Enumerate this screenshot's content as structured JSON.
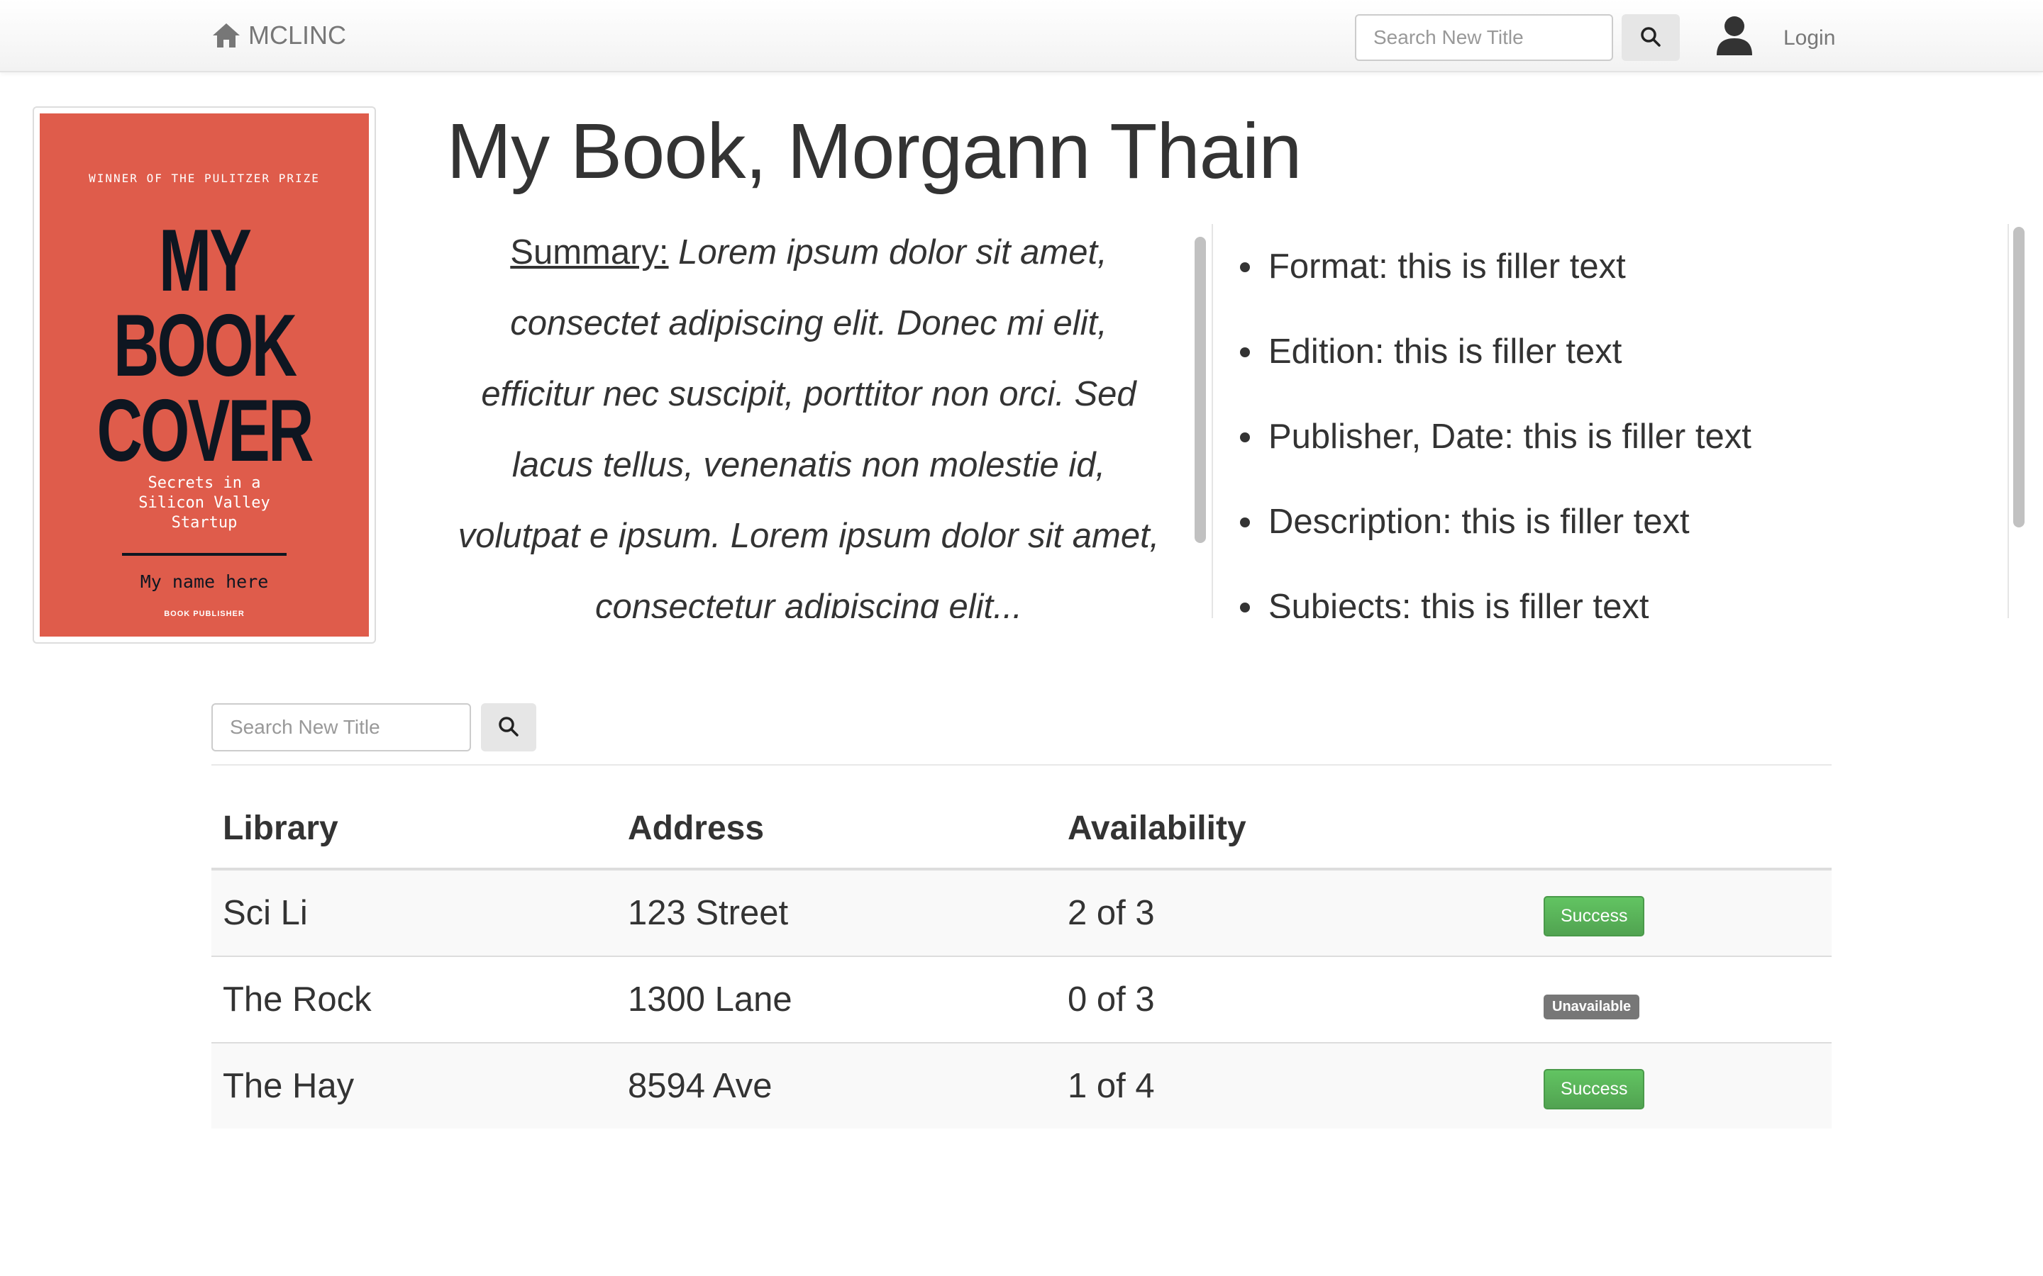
{
  "navbar": {
    "brand": "MCLINC",
    "search_placeholder": "Search New Title",
    "login_label": "Login"
  },
  "book": {
    "title": "My Book, Morgann Thain",
    "cover": {
      "prize": "WINNER OF THE PULITZER PRIZE",
      "line1": "MY",
      "line2": "BOOK",
      "line3": "COVER",
      "subtitle1": "Secrets in a",
      "subtitle2": "Silicon Valley",
      "subtitle3": "Startup",
      "author": "My name here",
      "publisher": "BOOK PUBLISHER"
    },
    "summary_label": "Summary:",
    "summary_text": " Lorem ipsum dolor sit amet, consectet adipiscing elit. Donec mi elit, efficitur nec suscipit, porttitor non orci. Sed lacus tellus, venenatis non molestie id, volutpat e ipsum. Lorem ipsum dolor sit amet, consectetur adipiscing elit...",
    "details": [
      "Format: this is filler text",
      "Edition: this is filler text",
      "Publisher, Date: this is filler text",
      "Description: this is filler text",
      "Subjects: this is filler text"
    ]
  },
  "library_search": {
    "placeholder": "Search New Title"
  },
  "table": {
    "headers": [
      "Library",
      "Address",
      "Availability"
    ],
    "rows": [
      {
        "library": "Sci Li",
        "address": "123 Street",
        "availability": "2 of 3",
        "status": "Success"
      },
      {
        "library": "The Rock",
        "address": "1300 Lane",
        "availability": "0 of 3",
        "status": "Unavailable"
      },
      {
        "library": "The Hay",
        "address": "8594 Ave",
        "availability": "1 of 4",
        "status": "Success"
      }
    ]
  },
  "colors": {
    "cover_red": "#df5c4b",
    "success_green": "#5cb85c",
    "unavailable_gray": "#777777"
  }
}
